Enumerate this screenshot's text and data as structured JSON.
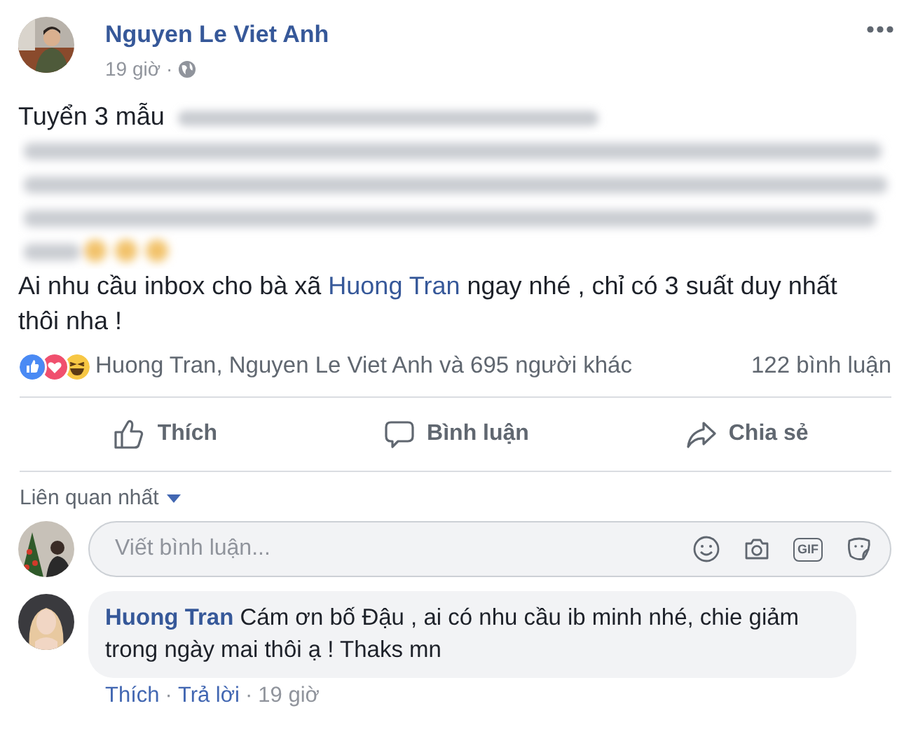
{
  "post": {
    "author": "Nguyen Le Viet Anh",
    "time": "19 giờ",
    "separator": "·",
    "intro": "Tuyển 3 mẫu",
    "message": [
      {
        "kind": "plain",
        "text": "Ai nhu cầu inbox cho bà xã "
      },
      {
        "kind": "mention",
        "text": "Huong Tran"
      },
      {
        "kind": "plain",
        "text": " ngay nhé , chỉ có 3 suất duy nhất thôi nha !"
      }
    ]
  },
  "reactions": {
    "icons": [
      {
        "kind": "like"
      },
      {
        "kind": "love"
      },
      {
        "kind": "haha"
      }
    ],
    "summary": "Huong Tran, Nguyen Le Viet Anh và 695 người khác",
    "comments": "122 bình luận"
  },
  "actions": [
    {
      "kind": "like",
      "label": "Thích"
    },
    {
      "kind": "comment",
      "label": "Bình luận"
    },
    {
      "kind": "share",
      "label": "Chia sẻ"
    }
  ],
  "sort": "Liên quan nhất",
  "composer": {
    "placeholder": "Viết bình luận...",
    "tools": [
      {
        "kind": "emoji"
      },
      {
        "kind": "camera"
      },
      {
        "kind": "gif"
      },
      {
        "kind": "sticker"
      }
    ],
    "gif": "GIF"
  },
  "comment": {
    "author": "Huong Tran",
    "text": "Cám ơn bố Đậu , ai có nhu cầu ib minh nhé, chie giảm trong ngày mai thôi ạ ! Thaks mn",
    "links": [
      "Thích",
      "Trả lời"
    ],
    "separator": "·",
    "time": "19 giờ"
  }
}
